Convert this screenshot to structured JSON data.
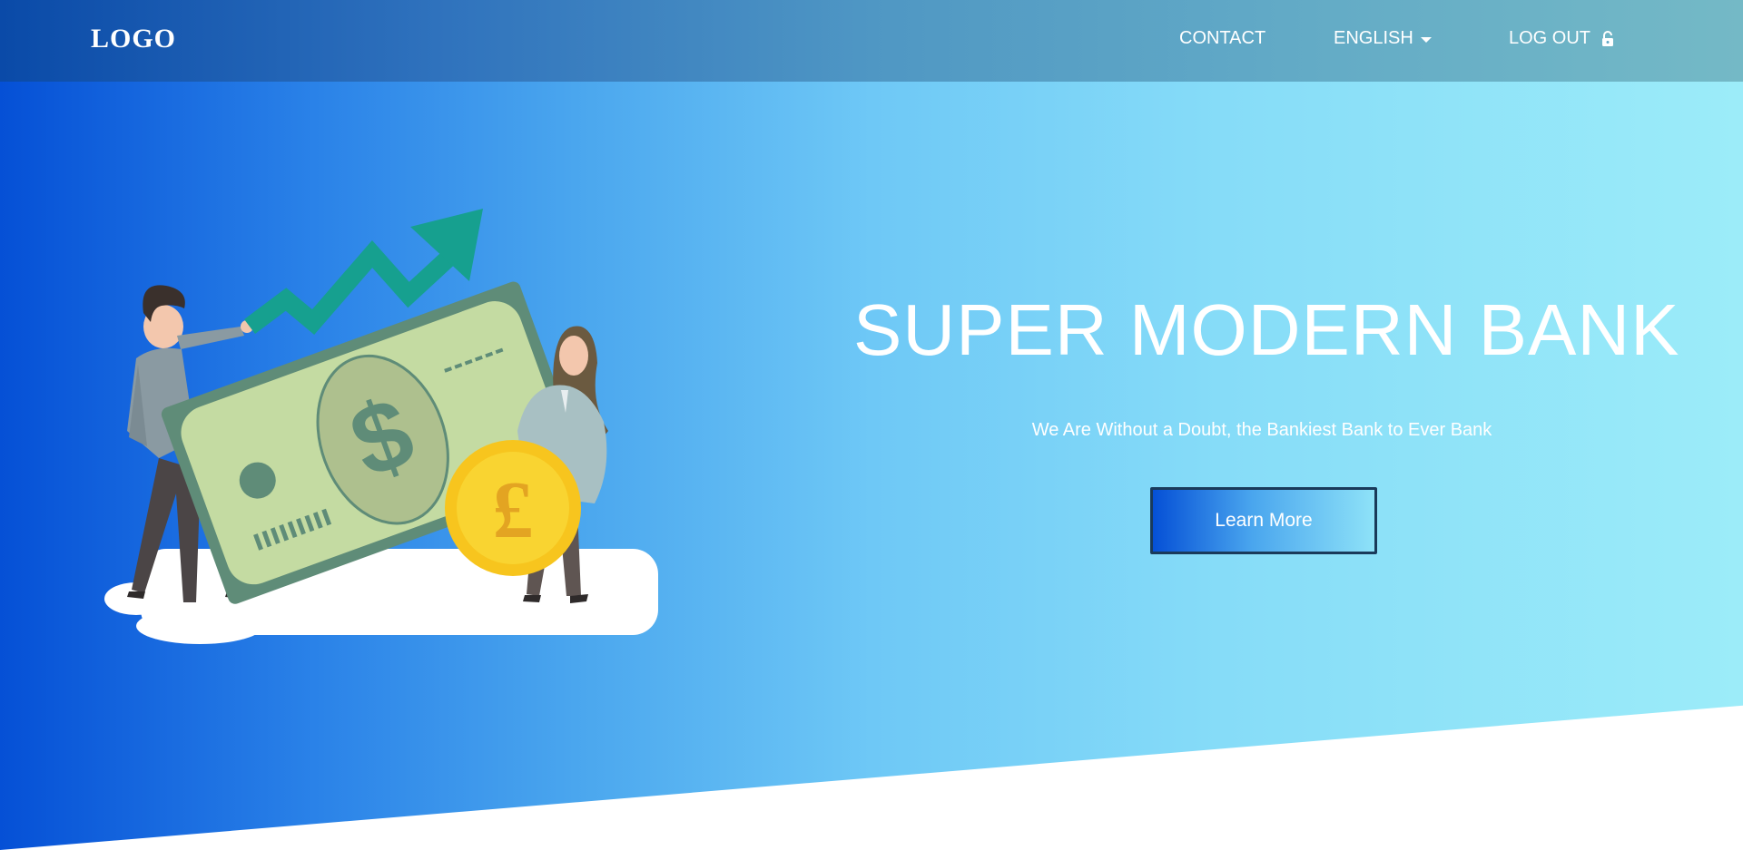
{
  "header": {
    "logo": "LOGO",
    "nav": {
      "contact": "CONTACT",
      "language": "ENGLISH",
      "logout": "LOG OUT"
    },
    "icons": {
      "language_caret": "caret-down-icon",
      "logout": "unlock-icon"
    }
  },
  "hero": {
    "title": "SUPER MODERN BANK",
    "subtitle": "We Are Without a Doubt, the Bankiest Bank to Ever Bank",
    "cta_label": "Learn More",
    "illustration": {
      "banknote_symbol": "$",
      "coin_symbol": "£"
    }
  },
  "colors": {
    "gradient_start": "#0550d6",
    "gradient_end": "#9cecf9",
    "arrow": "#16a08f",
    "banknote": "#c4dba2",
    "coin": "#f7c51e"
  }
}
